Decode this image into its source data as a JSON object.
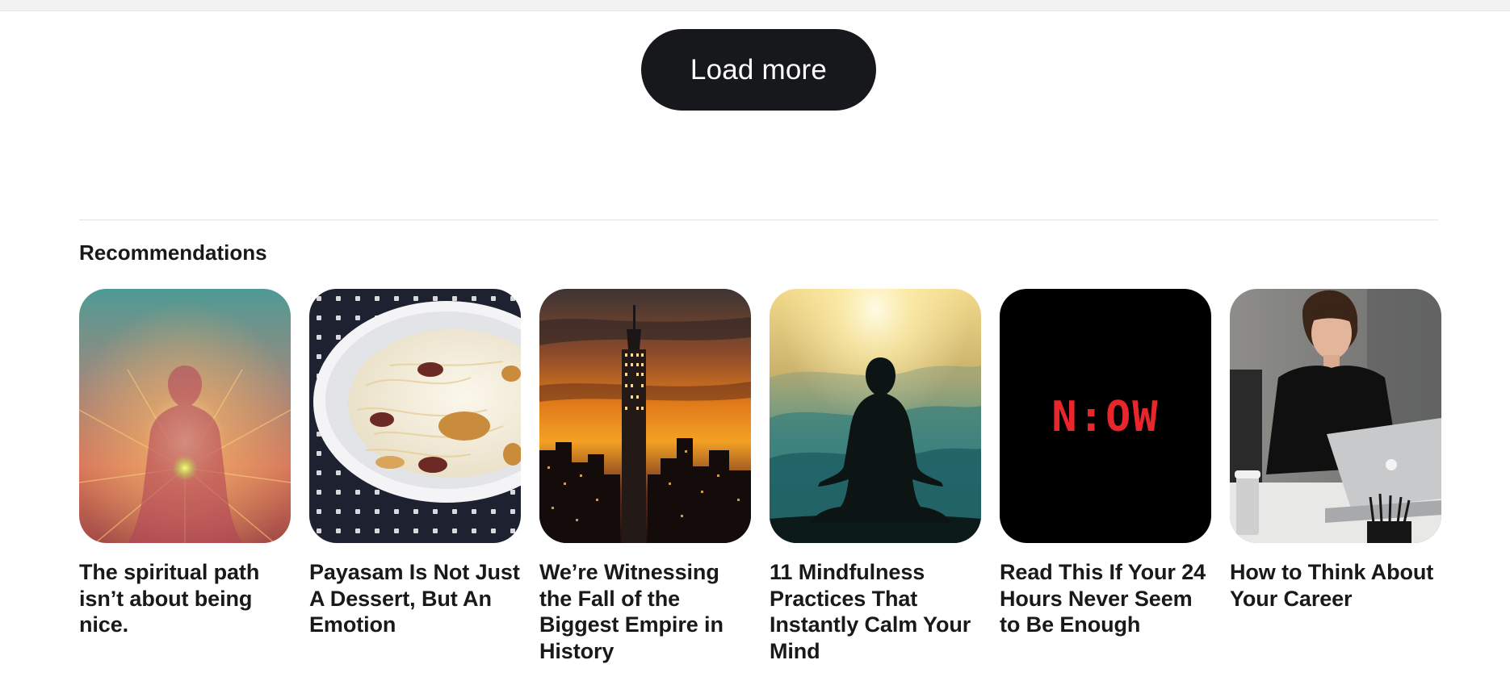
{
  "load_more": {
    "label": "Load more"
  },
  "recommendations": {
    "heading": "Recommendations",
    "items": [
      {
        "title": "The spiritual path isn’t about being nice.",
        "image": "spiritual-aura-image"
      },
      {
        "title": "Payasam Is Not Just A Dessert, But An Emotion",
        "image": "payasam-bowl-image"
      },
      {
        "title": "We’re Witnessing the Fall of the Biggest Empire in History",
        "image": "empire-state-sunset-image"
      },
      {
        "title": "11 Mindfulness Practices That Instantly Calm Your Mind",
        "image": "meditation-silhouette-image"
      },
      {
        "title": "Read This If Your 24 Hours Never Seem to Be Enough",
        "image": "now-clock-image",
        "image_text": "N:OW"
      },
      {
        "title": "How to Think About Your Career",
        "image": "woman-laptop-image"
      }
    ]
  },
  "colors": {
    "button_bg": "#16181b",
    "button_text": "#ffffff",
    "text": "#191919",
    "divider": "#e3e3e3",
    "clock_red": "#e8262b"
  }
}
